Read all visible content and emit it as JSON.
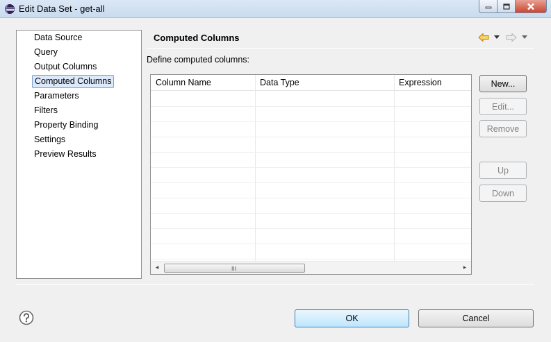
{
  "window": {
    "title": "Edit Data Set - get-all"
  },
  "nav": {
    "items": [
      {
        "label": "Data Source"
      },
      {
        "label": "Query"
      },
      {
        "label": "Output Columns"
      },
      {
        "label": "Computed Columns",
        "selected": true
      },
      {
        "label": "Parameters"
      },
      {
        "label": "Filters"
      },
      {
        "label": "Property Binding"
      },
      {
        "label": "Settings"
      },
      {
        "label": "Preview Results"
      }
    ]
  },
  "pane": {
    "title": "Computed Columns",
    "define_label": "Define computed columns:"
  },
  "table": {
    "columns": [
      "Column Name",
      "Data Type",
      "Expression"
    ]
  },
  "side_buttons": {
    "new": "New...",
    "edit": "Edit...",
    "remove": "Remove",
    "up": "Up",
    "down": "Down"
  },
  "footer": {
    "ok": "OK",
    "cancel": "Cancel"
  },
  "icons": {
    "app": "eclipse-icon",
    "help": "help-icon",
    "back": "back-arrow-icon",
    "forward": "forward-arrow-icon"
  },
  "colors": {
    "selection": "#dbe9fb",
    "back_arrow": "#e8a21a"
  }
}
